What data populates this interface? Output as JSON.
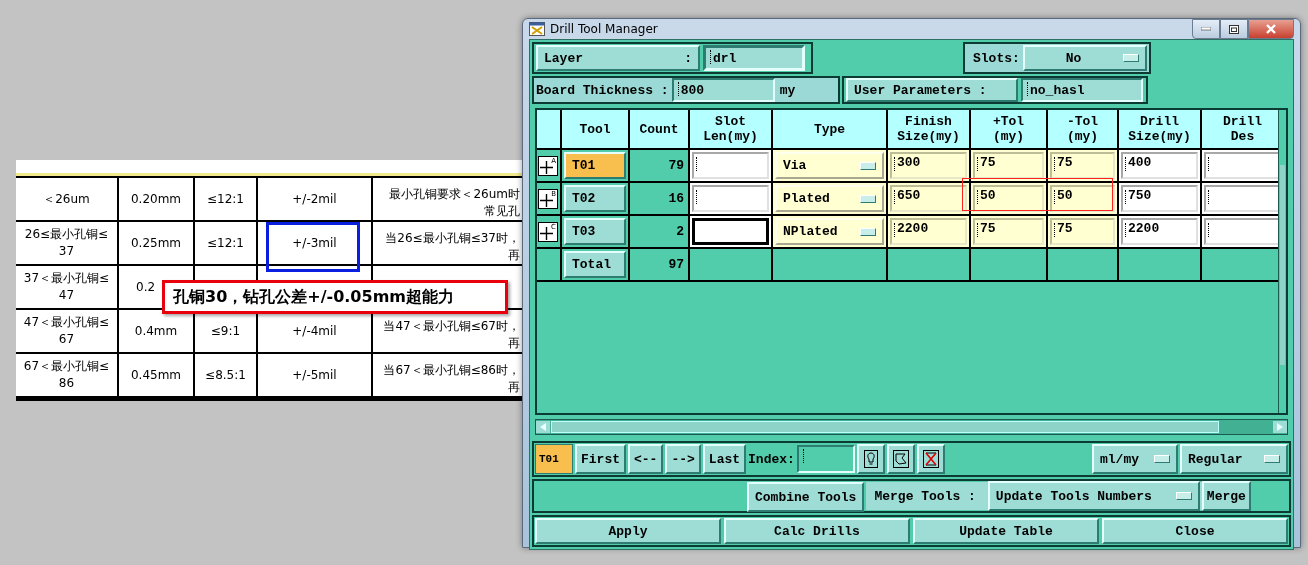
{
  "spreadsheet": {
    "rows": [
      {
        "cells": [
          "＜26um",
          "0.20mm",
          "≤12:1",
          "+/-2mil",
          [
            "最小孔铜要求＜26um时",
            "常见孔"
          ]
        ]
      },
      {
        "cells": [
          "26≤最小孔铜≤\n37",
          "0.25mm",
          "≤12:1",
          "+/-3mil",
          [
            "当26≤最小孔铜≤37时，",
            "再"
          ]
        ]
      },
      {
        "cells": [
          "37＜最小孔铜≤\n47",
          "0.2",
          null,
          null,
          null
        ]
      },
      {
        "cells": [
          "47＜最小孔铜≤\n67",
          "0.4mm",
          "≤9:1",
          "+/-4mil",
          [
            "当47＜最小孔铜≤67时，",
            "再"
          ]
        ]
      },
      {
        "cells": [
          "67＜最小孔铜≤\n86",
          "0.45mm",
          "≤8.5:1",
          "+/-5mil",
          [
            "当67＜最小孔铜≤86时，",
            "再"
          ]
        ]
      }
    ],
    "callout": "孔铜30，钻孔公差+/-0.05mm超能力"
  },
  "window": {
    "title": "Drill Tool Manager",
    "layer_label": "Layer",
    "layer_colon": ":",
    "layer_value": "drl",
    "slots_label": "Slots:",
    "slots_value": "No",
    "board_thickness_label": "Board Thickness :",
    "board_thickness_value": "800",
    "thickness_unit": "my",
    "user_parameters_button": "User Parameters :",
    "user_parameters_value": "no_hasl",
    "table": {
      "columns": [
        "Tool",
        "Count",
        "Slot\nLen(my)",
        "Type",
        "Finish\nSize(my)",
        "+Tol\n(my)",
        "-Tol\n(my)",
        "Drill\nSize(my)",
        "Drill\nDes"
      ],
      "rows": [
        {
          "marker": "A",
          "tool": "T01",
          "selected": true,
          "count": "79",
          "slot_len_focused": false,
          "type": "Via",
          "finish": "300",
          "plus_tol": "75",
          "minus_tol": "75",
          "drill_size": "400"
        },
        {
          "marker": "B",
          "tool": "T02",
          "selected": false,
          "count": "16",
          "slot_len_focused": false,
          "type": "Plated",
          "finish": "650",
          "plus_tol": "50",
          "minus_tol": "50",
          "drill_size": "750"
        },
        {
          "marker": "C",
          "tool": "T03",
          "selected": false,
          "count": "2",
          "slot_len_focused": true,
          "type": "NPlated",
          "finish": "2200",
          "plus_tol": "75",
          "minus_tol": "75",
          "drill_size": "2200"
        }
      ],
      "total": {
        "label": "Total",
        "count": "97"
      }
    },
    "toolbar": {
      "current_tool": "T01",
      "nav_buttons": [
        "First",
        "<--",
        "-->",
        "Last"
      ],
      "index_label": "Index:",
      "unit_dropdown": "ml/my",
      "mode_dropdown": "Regular"
    },
    "merge_row": {
      "combine_button": "Combine Tools",
      "merge_label": "Merge Tools :",
      "merge_dropdown": "Update Tools Numbers",
      "merge_button": "Merge"
    },
    "actions": [
      "Apply",
      "Calc Drills",
      "Update Table",
      "Close"
    ]
  }
}
